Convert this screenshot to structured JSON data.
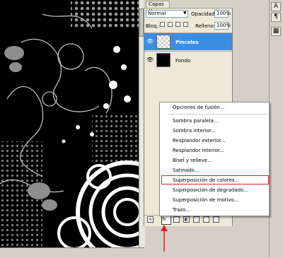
{
  "canvas": {
    "background": "#000000",
    "status_text": ""
  },
  "layers_panel": {
    "tab_label": "Capas ×",
    "blend_mode": "Normal",
    "opacity_label": "Opacidad:",
    "opacity_value": "100%",
    "lock_label": "Bloq.:",
    "fill_label": "Relleno:",
    "fill_value": "100%",
    "layers": [
      {
        "name": "Pinceles",
        "selected": true
      },
      {
        "name": "Fondo",
        "selected": false
      }
    ],
    "fx_label": "fx"
  },
  "context_menu": {
    "items": [
      "Opciones de fusión...",
      "Sombra paralela...",
      "Sombra interior...",
      "Resplandor exterior...",
      "Resplandor interior...",
      "Bisel y relieve...",
      "Satinado...",
      "Superposición de colores...",
      "Superposición de degradado...",
      "Superposición de motivo...",
      "Trazo..."
    ],
    "highlighted_index": 7,
    "highlight_color": "#d02030"
  },
  "right_dock": {
    "buttons": [
      "A",
      "¶",
      "▦"
    ]
  },
  "colors": {
    "selection": "#3d8ee0",
    "arrow": "#e0202a"
  }
}
